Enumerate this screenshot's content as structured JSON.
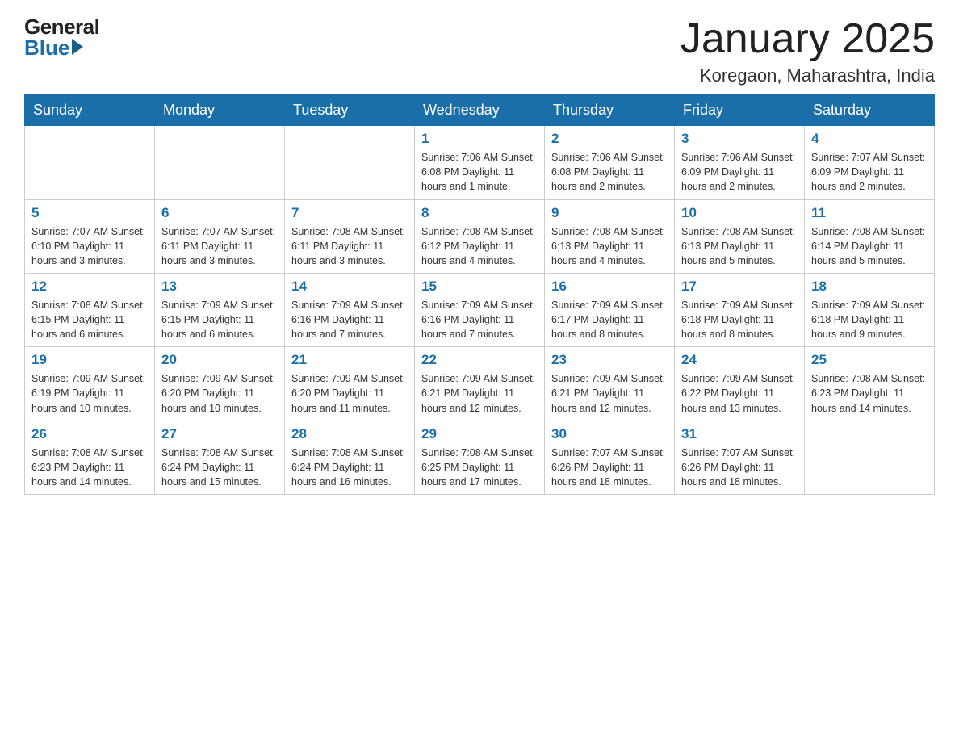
{
  "header": {
    "logo_general": "General",
    "logo_blue": "Blue",
    "month_title": "January 2025",
    "location": "Koregaon, Maharashtra, India"
  },
  "days_of_week": [
    "Sunday",
    "Monday",
    "Tuesday",
    "Wednesday",
    "Thursday",
    "Friday",
    "Saturday"
  ],
  "weeks": [
    [
      {
        "day": "",
        "info": ""
      },
      {
        "day": "",
        "info": ""
      },
      {
        "day": "",
        "info": ""
      },
      {
        "day": "1",
        "info": "Sunrise: 7:06 AM\nSunset: 6:08 PM\nDaylight: 11 hours and 1 minute."
      },
      {
        "day": "2",
        "info": "Sunrise: 7:06 AM\nSunset: 6:08 PM\nDaylight: 11 hours and 2 minutes."
      },
      {
        "day": "3",
        "info": "Sunrise: 7:06 AM\nSunset: 6:09 PM\nDaylight: 11 hours and 2 minutes."
      },
      {
        "day": "4",
        "info": "Sunrise: 7:07 AM\nSunset: 6:09 PM\nDaylight: 11 hours and 2 minutes."
      }
    ],
    [
      {
        "day": "5",
        "info": "Sunrise: 7:07 AM\nSunset: 6:10 PM\nDaylight: 11 hours and 3 minutes."
      },
      {
        "day": "6",
        "info": "Sunrise: 7:07 AM\nSunset: 6:11 PM\nDaylight: 11 hours and 3 minutes."
      },
      {
        "day": "7",
        "info": "Sunrise: 7:08 AM\nSunset: 6:11 PM\nDaylight: 11 hours and 3 minutes."
      },
      {
        "day": "8",
        "info": "Sunrise: 7:08 AM\nSunset: 6:12 PM\nDaylight: 11 hours and 4 minutes."
      },
      {
        "day": "9",
        "info": "Sunrise: 7:08 AM\nSunset: 6:13 PM\nDaylight: 11 hours and 4 minutes."
      },
      {
        "day": "10",
        "info": "Sunrise: 7:08 AM\nSunset: 6:13 PM\nDaylight: 11 hours and 5 minutes."
      },
      {
        "day": "11",
        "info": "Sunrise: 7:08 AM\nSunset: 6:14 PM\nDaylight: 11 hours and 5 minutes."
      }
    ],
    [
      {
        "day": "12",
        "info": "Sunrise: 7:08 AM\nSunset: 6:15 PM\nDaylight: 11 hours and 6 minutes."
      },
      {
        "day": "13",
        "info": "Sunrise: 7:09 AM\nSunset: 6:15 PM\nDaylight: 11 hours and 6 minutes."
      },
      {
        "day": "14",
        "info": "Sunrise: 7:09 AM\nSunset: 6:16 PM\nDaylight: 11 hours and 7 minutes."
      },
      {
        "day": "15",
        "info": "Sunrise: 7:09 AM\nSunset: 6:16 PM\nDaylight: 11 hours and 7 minutes."
      },
      {
        "day": "16",
        "info": "Sunrise: 7:09 AM\nSunset: 6:17 PM\nDaylight: 11 hours and 8 minutes."
      },
      {
        "day": "17",
        "info": "Sunrise: 7:09 AM\nSunset: 6:18 PM\nDaylight: 11 hours and 8 minutes."
      },
      {
        "day": "18",
        "info": "Sunrise: 7:09 AM\nSunset: 6:18 PM\nDaylight: 11 hours and 9 minutes."
      }
    ],
    [
      {
        "day": "19",
        "info": "Sunrise: 7:09 AM\nSunset: 6:19 PM\nDaylight: 11 hours and 10 minutes."
      },
      {
        "day": "20",
        "info": "Sunrise: 7:09 AM\nSunset: 6:20 PM\nDaylight: 11 hours and 10 minutes."
      },
      {
        "day": "21",
        "info": "Sunrise: 7:09 AM\nSunset: 6:20 PM\nDaylight: 11 hours and 11 minutes."
      },
      {
        "day": "22",
        "info": "Sunrise: 7:09 AM\nSunset: 6:21 PM\nDaylight: 11 hours and 12 minutes."
      },
      {
        "day": "23",
        "info": "Sunrise: 7:09 AM\nSunset: 6:21 PM\nDaylight: 11 hours and 12 minutes."
      },
      {
        "day": "24",
        "info": "Sunrise: 7:09 AM\nSunset: 6:22 PM\nDaylight: 11 hours and 13 minutes."
      },
      {
        "day": "25",
        "info": "Sunrise: 7:08 AM\nSunset: 6:23 PM\nDaylight: 11 hours and 14 minutes."
      }
    ],
    [
      {
        "day": "26",
        "info": "Sunrise: 7:08 AM\nSunset: 6:23 PM\nDaylight: 11 hours and 14 minutes."
      },
      {
        "day": "27",
        "info": "Sunrise: 7:08 AM\nSunset: 6:24 PM\nDaylight: 11 hours and 15 minutes."
      },
      {
        "day": "28",
        "info": "Sunrise: 7:08 AM\nSunset: 6:24 PM\nDaylight: 11 hours and 16 minutes."
      },
      {
        "day": "29",
        "info": "Sunrise: 7:08 AM\nSunset: 6:25 PM\nDaylight: 11 hours and 17 minutes."
      },
      {
        "day": "30",
        "info": "Sunrise: 7:07 AM\nSunset: 6:26 PM\nDaylight: 11 hours and 18 minutes."
      },
      {
        "day": "31",
        "info": "Sunrise: 7:07 AM\nSunset: 6:26 PM\nDaylight: 11 hours and 18 minutes."
      },
      {
        "day": "",
        "info": ""
      }
    ]
  ]
}
